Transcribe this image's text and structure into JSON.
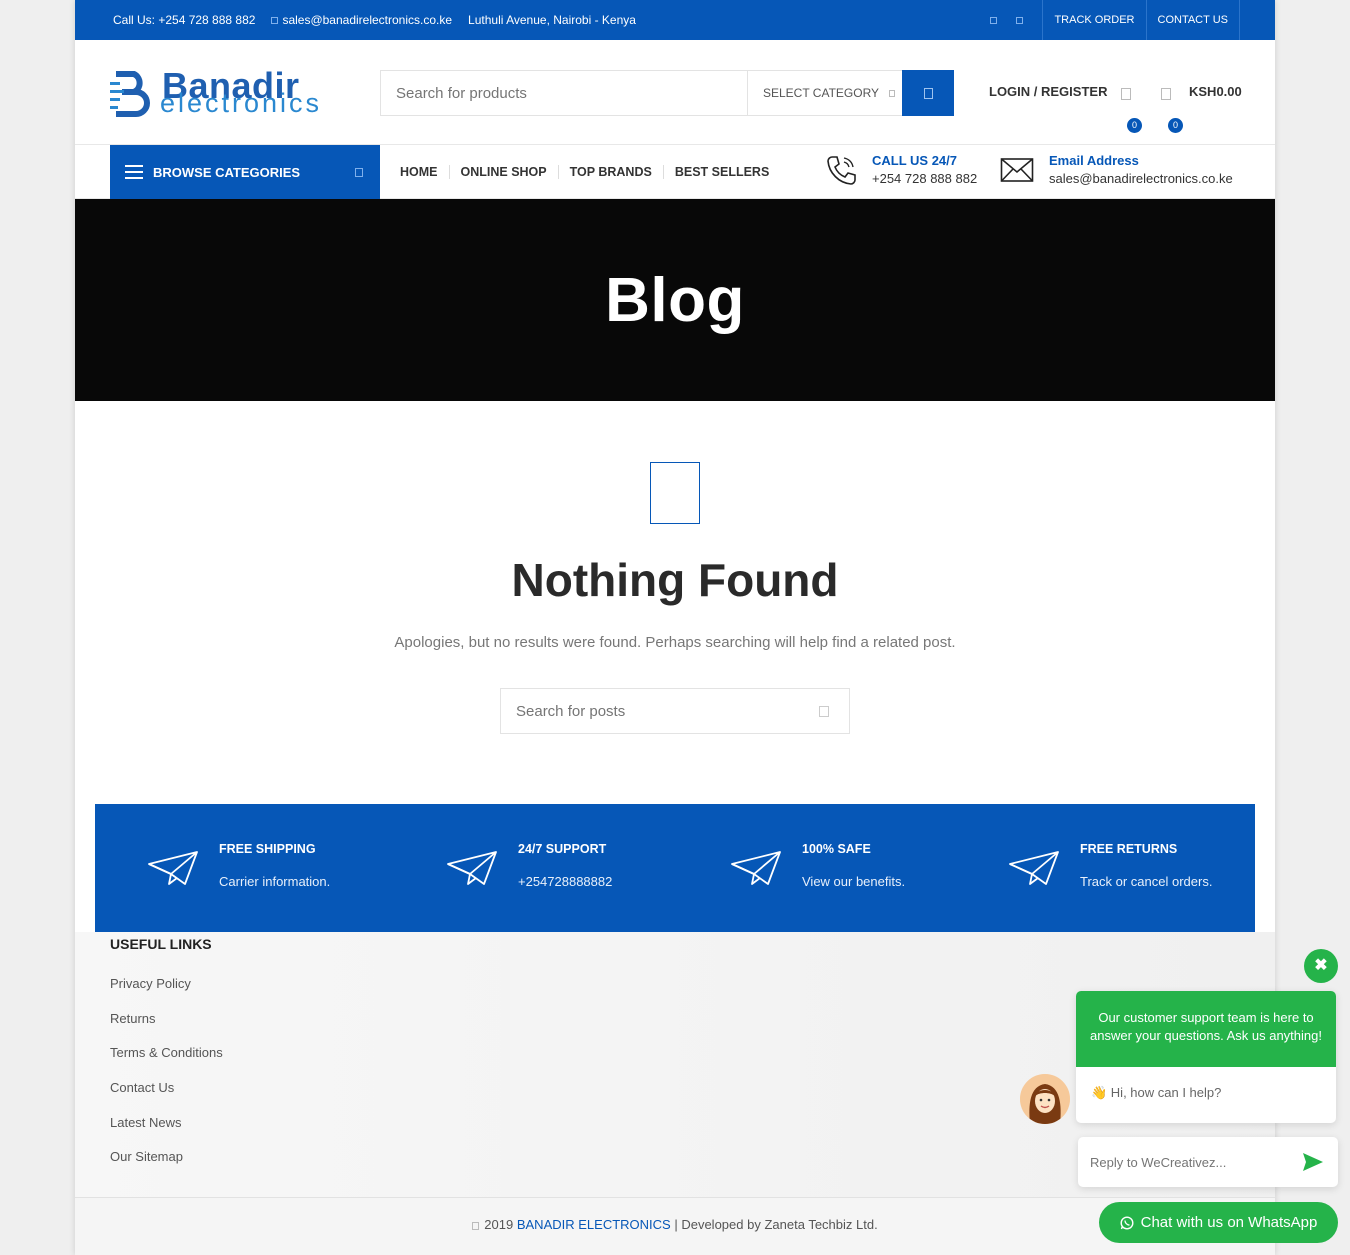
{
  "topbar": {
    "phone": "Call Us: +254 728 888 882",
    "email": "sales@banadirelectronics.co.ke",
    "address": "Luthuli Avenue, Nairobi - Kenya",
    "links": [
      "TRACK ORDER",
      "CONTACT US"
    ]
  },
  "header": {
    "brand_top": "Banadir",
    "brand_bottom": "electronics",
    "search_placeholder": "Search for products",
    "category_label": "SELECT CATEGORY",
    "login_label": "LOGIN / REGISTER",
    "wishlist_count": "0",
    "cart_count": "0",
    "cart_total": "KSH0.00"
  },
  "nav": {
    "browse_label": "BROWSE CATEGORIES",
    "items": [
      "HOME",
      "ONLINE SHOP",
      "TOP BRANDS",
      "BEST SELLERS"
    ],
    "call_title": "CALL US 24/7",
    "call_number": "+254 728 888 882",
    "email_title": "Email Address",
    "email_value": "sales@banadirelectronics.co.ke"
  },
  "hero": {
    "title": "Blog"
  },
  "main": {
    "title": "Nothing Found",
    "message": "Apologies, but no results were found. Perhaps searching will help find a related post.",
    "search_placeholder": "Search for posts"
  },
  "features": [
    {
      "title": "FREE SHIPPING",
      "subtitle": "Carrier information."
    },
    {
      "title": "24/7 SUPPORT",
      "subtitle": "+254728888882"
    },
    {
      "title": "100% SAFE",
      "subtitle": "View our benefits."
    },
    {
      "title": "FREE RETURNS",
      "subtitle": "Track or cancel orders."
    }
  ],
  "footer": {
    "heading": "USEFUL LINKS",
    "links": [
      "Privacy Policy",
      "Returns",
      "Terms & Conditions",
      "Contact Us",
      "Latest News",
      "Our Sitemap"
    ],
    "copyright_year": "2019",
    "copyright_brand": "BANADIR ELECTRONICS",
    "developed_by": "| Developed by",
    "developer": "Zaneta Techbiz Ltd."
  },
  "chat": {
    "close": "✖",
    "header": "Our customer support team is here to answer your questions. Ask us anything!",
    "greeting": "👋 Hi, how can I help?",
    "reply_placeholder": "Reply to WeCreativez...",
    "whatsapp_label": "Chat with us on WhatsApp",
    "accent": "#25b34a"
  },
  "colors": {
    "brand_blue": "#0657b7",
    "hero_bg": "#080808"
  }
}
